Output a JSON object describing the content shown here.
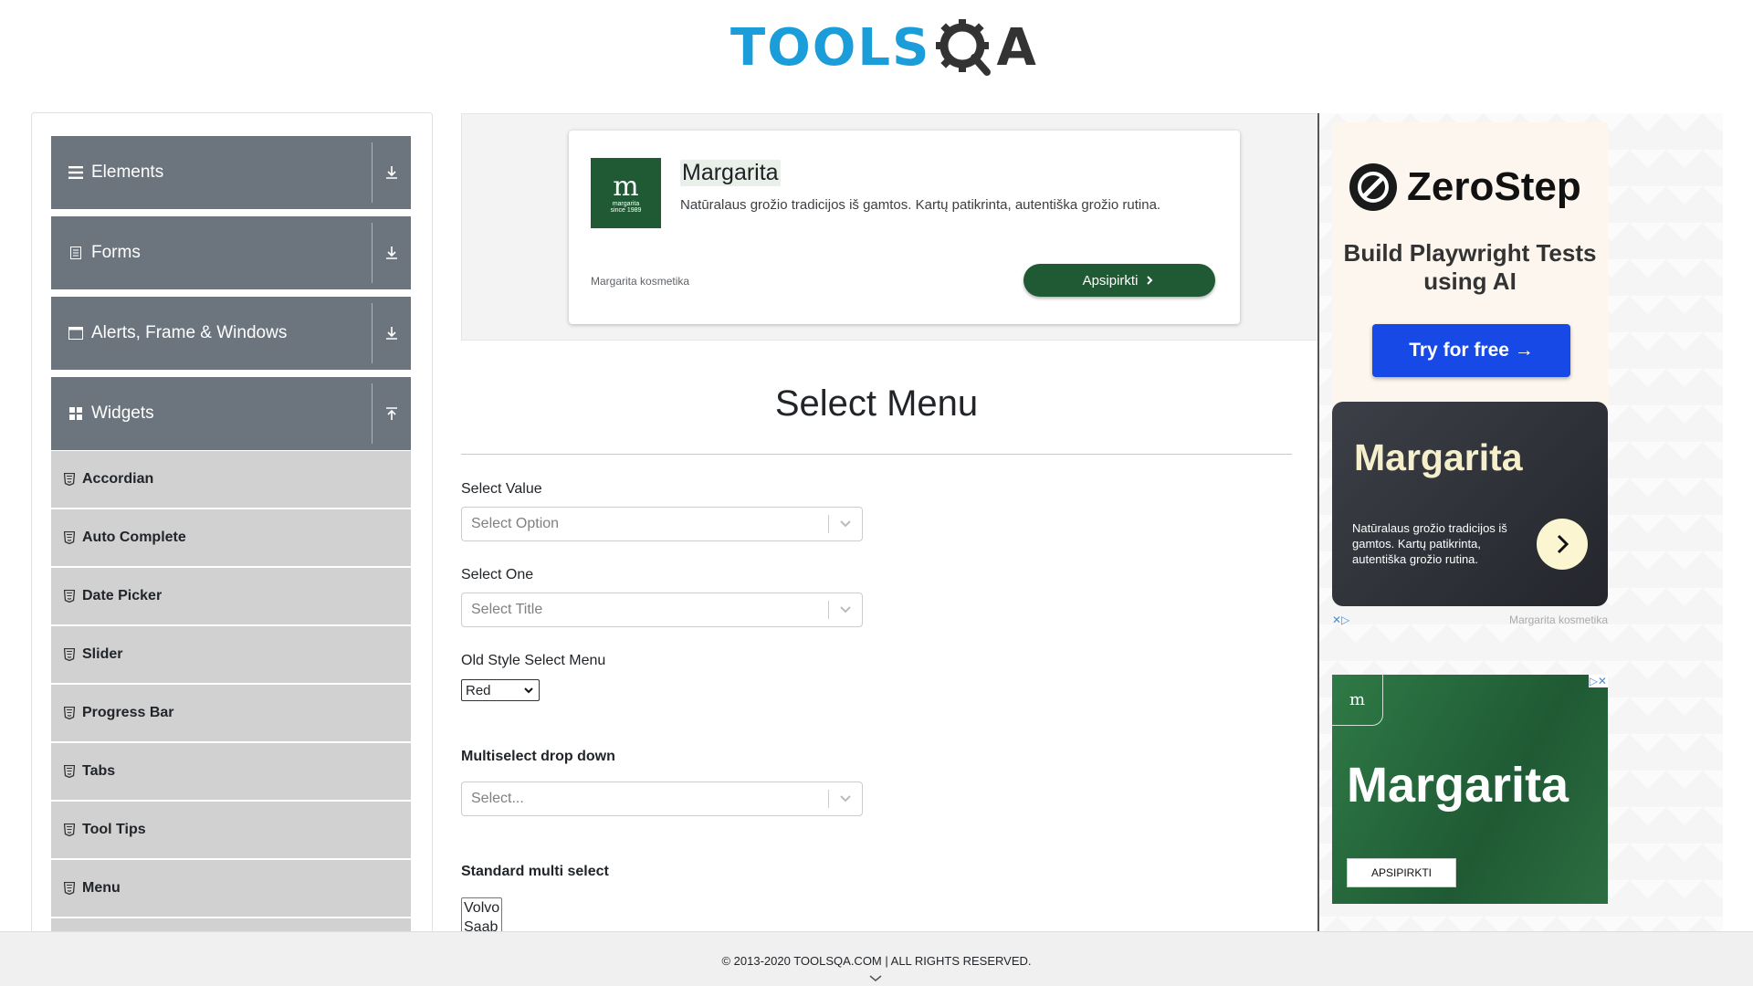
{
  "header": {
    "logo_text": "TOOLSQA"
  },
  "sidebar": {
    "groups": [
      {
        "label": "Elements",
        "icon": "hamburger-icon",
        "state": "collapsed"
      },
      {
        "label": "Forms",
        "icon": "document-icon",
        "state": "collapsed"
      },
      {
        "label": "Alerts, Frame & Windows",
        "icon": "window-icon",
        "state": "collapsed"
      },
      {
        "label": "Widgets",
        "icon": "grid-icon",
        "state": "expanded"
      }
    ],
    "widget_items": [
      "Accordian",
      "Auto Complete",
      "Date Picker",
      "Slider",
      "Progress Bar",
      "Tabs",
      "Tool Tips",
      "Menu"
    ]
  },
  "ad_top": {
    "title": "Margarita",
    "description": "Natūralaus grožio tradicijos iš gamtos. Kartų patikrinta, autentiška grožio rutina.",
    "brand": "Margarita kosmetika",
    "button": "Apsipirkti",
    "logo_text": "margarita",
    "logo_sub": "since 1989",
    "brand_color": "#1f5a34"
  },
  "main": {
    "title": "Select Menu",
    "select_value": {
      "label": "Select Value",
      "placeholder": "Select Option"
    },
    "select_one": {
      "label": "Select One",
      "placeholder": "Select Title"
    },
    "old_style": {
      "label": "Old Style Select Menu",
      "selected": "Red"
    },
    "multiselect": {
      "label": "Multiselect drop down",
      "placeholder": "Select..."
    },
    "standard_multi": {
      "label": "Standard multi select",
      "options": [
        "Volvo",
        "Saab"
      ]
    }
  },
  "right_ads": {
    "zerostep": {
      "brand": "ZeroStep",
      "tagline": "Build Playwright Tests using AI",
      "button": "Try for free →",
      "button_color": "#1749e6"
    },
    "margarita_card": {
      "title": "Margarita",
      "description": "Natūralaus grožio tradicijos iš gamtos. Kartų patikrinta, autentiška grožio rutina.",
      "brand": "Margarita kosmetika"
    },
    "margarita_banner": {
      "title": "Margarita",
      "button": "APSIPIRKTI"
    }
  },
  "footer": {
    "copyright": "© 2013-2020 TOOLSQA.COM | ALL RIGHTS RESERVED."
  }
}
